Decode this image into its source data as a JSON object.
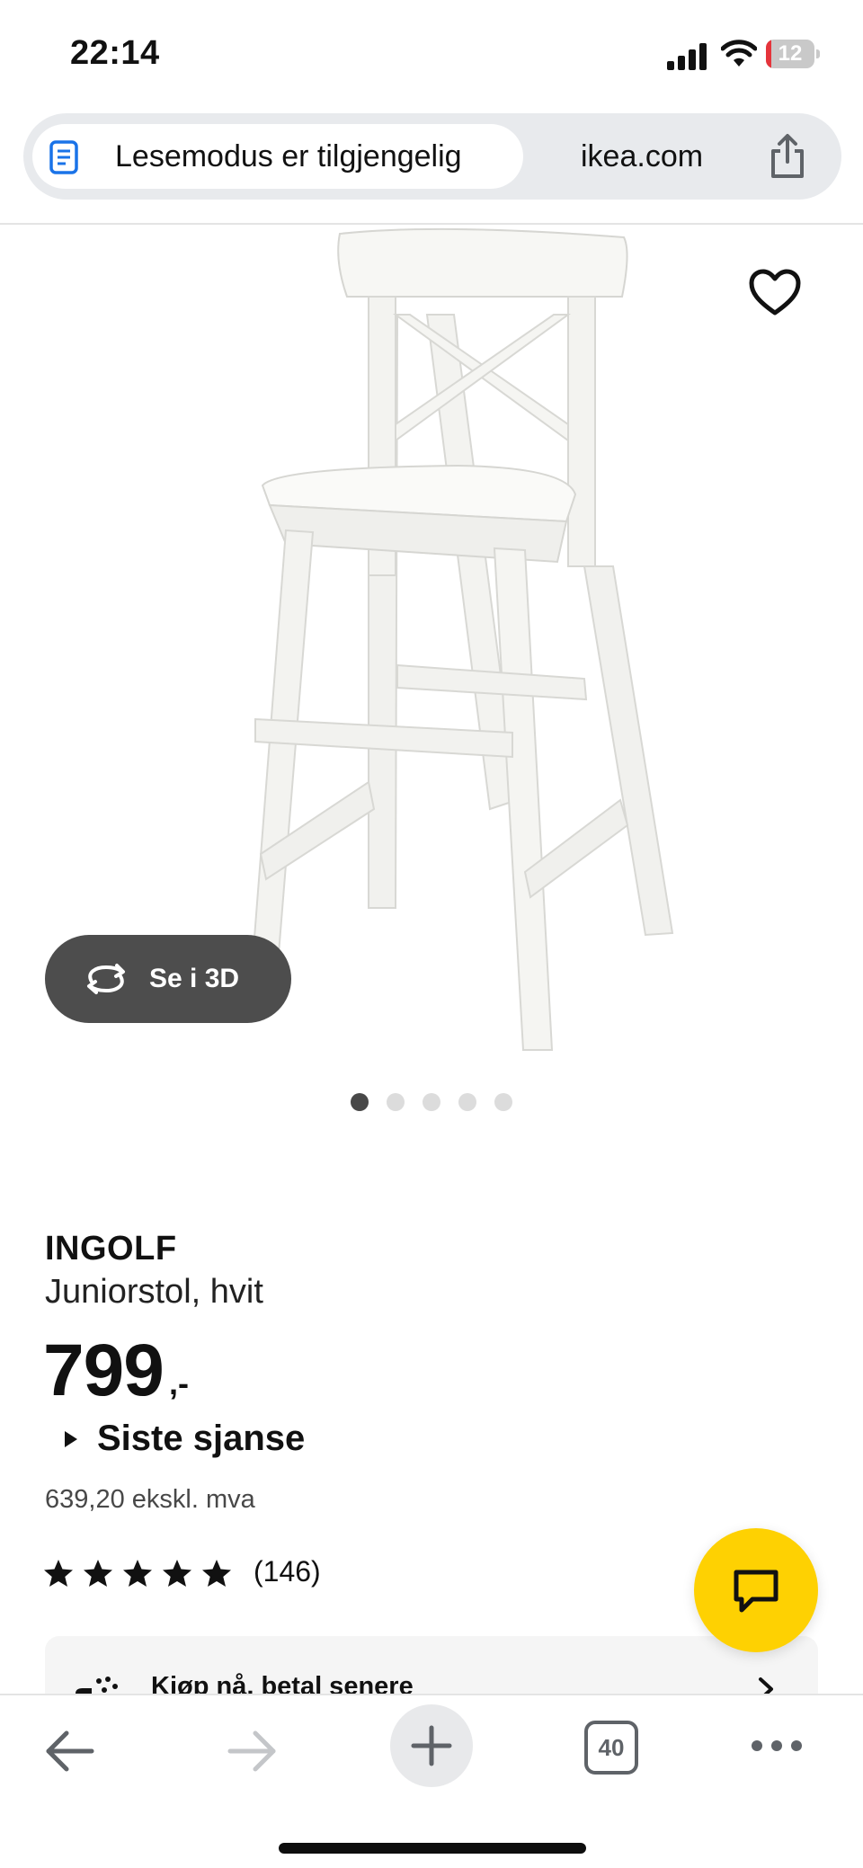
{
  "status_bar": {
    "time": "22:14",
    "battery_level": "12",
    "battery_fraction": 0.12,
    "icons": [
      "signal-icon",
      "wifi-icon",
      "battery-icon"
    ]
  },
  "address_bar": {
    "reader_mode_label": "Lesemodus er tilgjengelig",
    "domain": "ikea.com",
    "icons": [
      "reader-icon",
      "share-icon"
    ]
  },
  "product_gallery": {
    "view_3d_label": "Se i 3D",
    "image_count": 5,
    "active_image": 1,
    "icons": [
      "heart-icon",
      "rotate-icon"
    ]
  },
  "product": {
    "name": "INGOLF",
    "description": "Juniorstol, hvit",
    "price": "799",
    "price_suffix": ",-",
    "badge_label": "Siste sjanse",
    "price_ex_vat": "639,20 ekskl. mva",
    "rating_stars": 5,
    "review_count": "(146)"
  },
  "payment": {
    "klarna_label": "Kjøp nå, betal senere"
  },
  "toolbar": {
    "tab_count": "40",
    "icons": [
      "back-arrow-icon",
      "forward-arrow-icon",
      "plus-icon",
      "tabs-icon",
      "more-icon"
    ]
  },
  "colors": {
    "accent_yellow": "#fed102",
    "battery_low": "#e5343b",
    "button_dark": "#4d4d4d"
  }
}
